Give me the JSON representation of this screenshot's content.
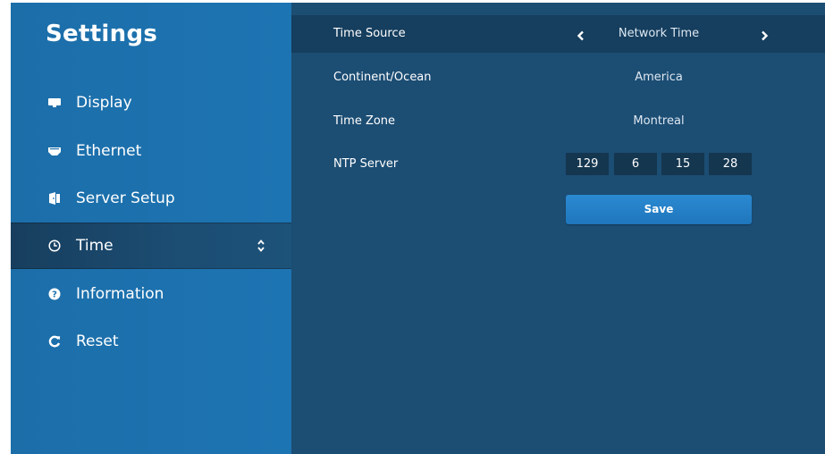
{
  "sidebar": {
    "title": "Settings",
    "items": [
      {
        "label": "Display",
        "icon": "monitor-icon"
      },
      {
        "label": "Ethernet",
        "icon": "ethernet-icon"
      },
      {
        "label": "Server Setup",
        "icon": "server-icon"
      },
      {
        "label": "Time",
        "icon": "clock-icon",
        "active": true
      },
      {
        "label": "Information",
        "icon": "question-circle-icon"
      },
      {
        "label": "Reset",
        "icon": "refresh-icon"
      }
    ]
  },
  "main": {
    "time_source": {
      "label": "Time Source",
      "value": "Network Time"
    },
    "continent": {
      "label": "Continent/Ocean",
      "value": "America"
    },
    "time_zone": {
      "label": "Time Zone",
      "value": "Montreal"
    },
    "ntp_server": {
      "label": "NTP Server",
      "octets": [
        "129",
        "6",
        "15",
        "28"
      ]
    },
    "save_label": "Save"
  },
  "colors": {
    "sidebar_bg": "#1d72af",
    "main_bg": "#1c4d73",
    "active_row_bg": "#163e5e",
    "button_bg": "#2583c8"
  }
}
